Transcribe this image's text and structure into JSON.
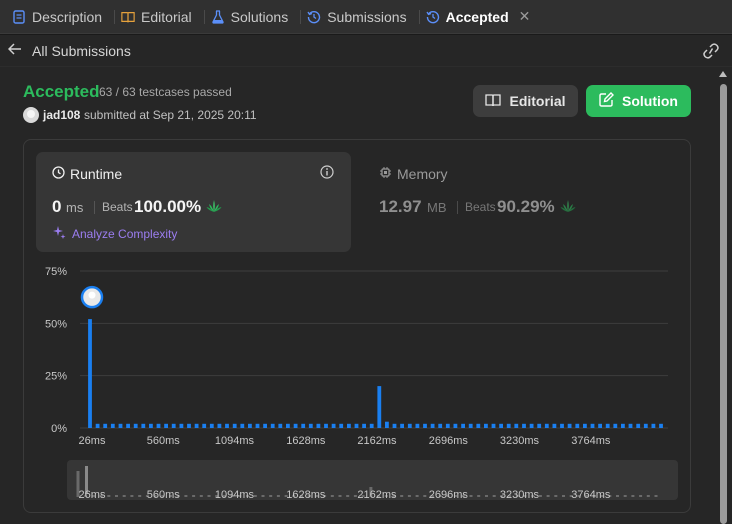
{
  "tabs": [
    {
      "label": "Description",
      "icon": "description-icon"
    },
    {
      "label": "Editorial",
      "icon": "book-icon"
    },
    {
      "label": "Solutions",
      "icon": "flask-icon"
    },
    {
      "label": "Submissions",
      "icon": "history-icon"
    },
    {
      "label": "Accepted",
      "icon": "history-icon",
      "active": true
    }
  ],
  "subheader": {
    "title": "All Submissions"
  },
  "result": {
    "status": "Accepted",
    "testcases": "63 / 63 testcases passed",
    "username": "jad108",
    "submitted": "submitted at Sep 21, 2025 20:11",
    "status_color": "#2cbb5d"
  },
  "buttons": {
    "editorial": "Editorial",
    "solution": "Solution"
  },
  "runtime": {
    "title": "Runtime",
    "value": "0",
    "unit": "ms",
    "beats_label": "Beats",
    "beats_value": "100.00%",
    "analyze": "Analyze Complexity"
  },
  "memory": {
    "title": "Memory",
    "value": "12.97",
    "unit": "MB",
    "beats_label": "Beats",
    "beats_value": "90.29%"
  },
  "chart_data": {
    "type": "bar",
    "ylim": [
      0,
      75
    ],
    "yticks": [
      "75%",
      "50%",
      "25%",
      "0%"
    ],
    "ytick_values": [
      75,
      50,
      25,
      0
    ],
    "xtick_labels": [
      "26ms",
      "560ms",
      "1094ms",
      "1628ms",
      "2162ms",
      "2696ms",
      "3230ms",
      "3764ms"
    ],
    "bar_count": 76,
    "bars": [
      52,
      2,
      2,
      2,
      2,
      2,
      2,
      2,
      2,
      2,
      2,
      2,
      2,
      2,
      2,
      2,
      2,
      2,
      2,
      2,
      2,
      2,
      2,
      2,
      2,
      2,
      2,
      2,
      2,
      2,
      2,
      2,
      2,
      2,
      2,
      2,
      2,
      2,
      20,
      3,
      2,
      2,
      2,
      2,
      2,
      2,
      2,
      2,
      2,
      2,
      2,
      2,
      2,
      2,
      2,
      2,
      2,
      2,
      2,
      2,
      2,
      2,
      2,
      2,
      2,
      2,
      2,
      2,
      2,
      2,
      2,
      2,
      2,
      2,
      2,
      2
    ],
    "highlight_index": 0,
    "bar_color": "#1a7ff0",
    "grid": true
  }
}
